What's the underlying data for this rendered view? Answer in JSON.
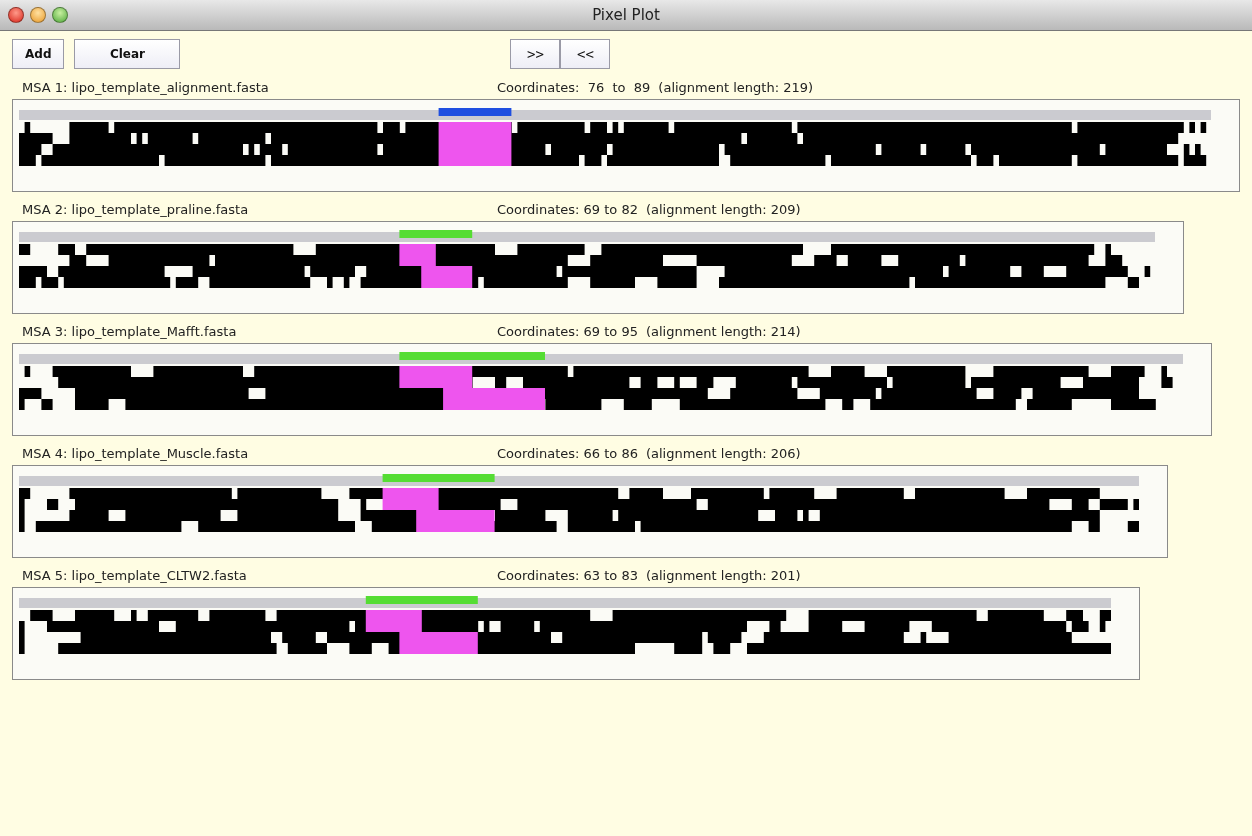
{
  "window": {
    "title": "Pixel Plot"
  },
  "toolbar": {
    "buttons": [
      "Add",
      "Clear"
    ],
    "nav_buttons": [
      ">>",
      "<<"
    ]
  },
  "alignments": [
    {
      "label": "MSA 1: lipo_template_alignment.fasta",
      "coordinates": "Coordinates:  76  to  89",
      "length_note": "(alignment length: 219)",
      "selected": true
    },
    {
      "label": "MSA 2: lipo_template_praline.fasta",
      "coordinates": "Coordinates: 69 to 82",
      "length_note": "(alignment length: 209)",
      "selected": false
    },
    {
      "label": "MSA 3: lipo_template_Mafft.fasta",
      "coordinates": "Coordinates: 69 to 95",
      "length_note": "(alignment length: 214)",
      "selected": false
    },
    {
      "label": "MSA 4: lipo_template_Muscle.fasta",
      "coordinates": "Coordinates: 66 to 86",
      "length_note": "(alignment length: 206)",
      "selected": false
    },
    {
      "label": "MSA 5: lipo_template_CLTW2.fasta",
      "coordinates": "Coordinates: 63 to 83",
      "length_note": "(alignment length: 201)",
      "selected": false
    }
  ]
}
